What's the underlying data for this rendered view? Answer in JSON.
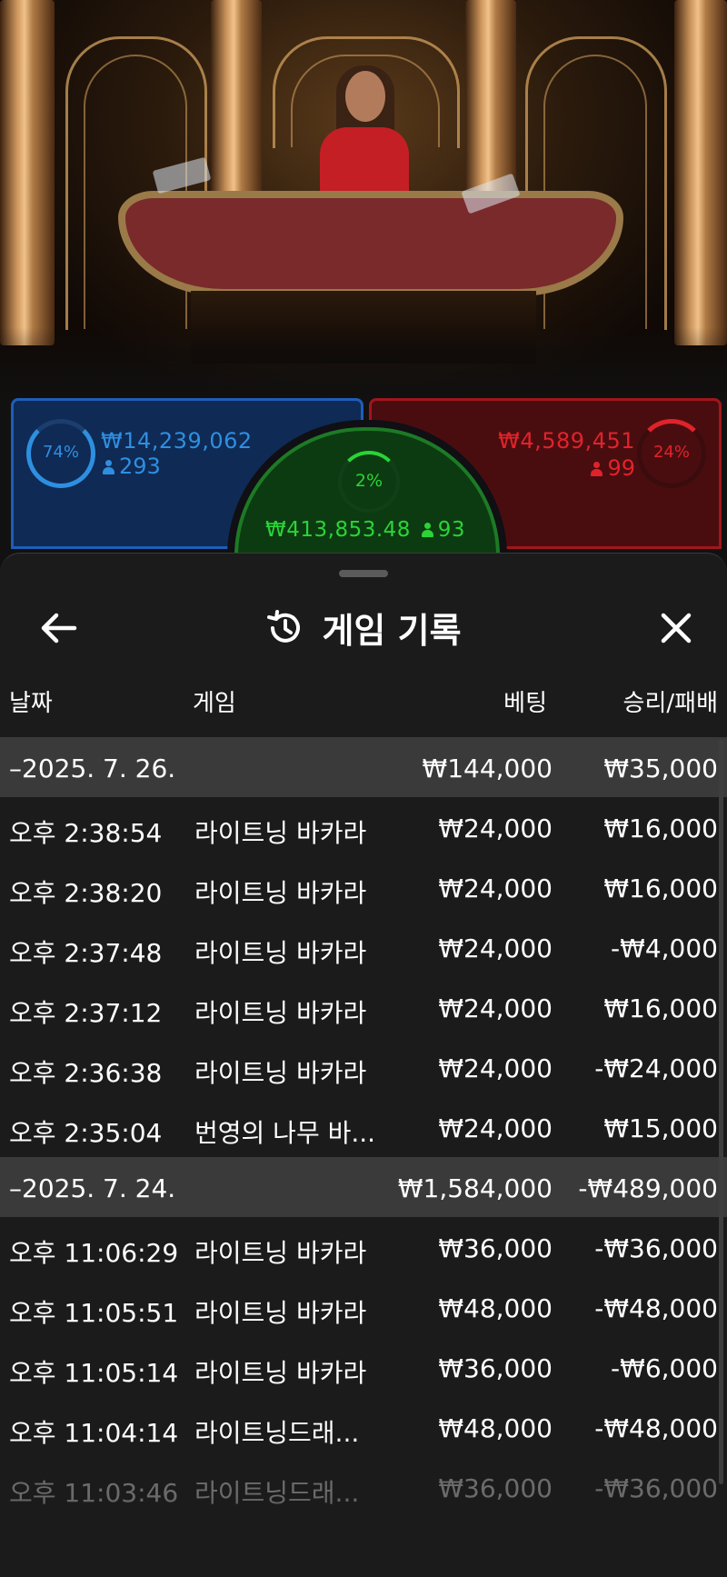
{
  "bet_panels": {
    "player": {
      "percent": "74%",
      "amount": "₩14,239,062",
      "players": "293",
      "color": "#2e8fe0"
    },
    "tie": {
      "percent": "2%",
      "amount": "₩413,853.48",
      "players": "93",
      "color": "#2bd338"
    },
    "banker": {
      "percent": "24%",
      "amount": "₩4,589,451",
      "players": "99",
      "color": "#e0232b"
    }
  },
  "sheet": {
    "title": "게임 기록",
    "icons": {
      "back": "arrow-left-icon",
      "history": "history-icon",
      "close": "close-icon"
    },
    "columns": {
      "date": "날짜",
      "game": "게임",
      "bet": "베팅",
      "win_loss": "승리/패배"
    },
    "groups": [
      {
        "date": "–2025. 7. 26.",
        "bet": "₩144,000",
        "win_loss": "₩35,000",
        "rows": [
          {
            "time": "오후 2:38:54",
            "game": "라이트닝 바카라",
            "bet": "₩24,000",
            "win_loss": "₩16,000"
          },
          {
            "time": "오후 2:38:20",
            "game": "라이트닝 바카라",
            "bet": "₩24,000",
            "win_loss": "₩16,000"
          },
          {
            "time": "오후 2:37:48",
            "game": "라이트닝 바카라",
            "bet": "₩24,000",
            "win_loss": "-₩4,000"
          },
          {
            "time": "오후 2:37:12",
            "game": "라이트닝 바카라",
            "bet": "₩24,000",
            "win_loss": "₩16,000"
          },
          {
            "time": "오후 2:36:38",
            "game": "라이트닝 바카라",
            "bet": "₩24,000",
            "win_loss": "-₩24,000"
          },
          {
            "time": "오후 2:35:04",
            "game": "번영의 나무 바...",
            "bet": "₩24,000",
            "win_loss": "₩15,000"
          }
        ]
      },
      {
        "date": "–2025. 7. 24.",
        "bet": "₩1,584,000",
        "win_loss": "-₩489,000",
        "rows": [
          {
            "time": "오후 11:06:29",
            "game": "라이트닝 바카라",
            "bet": "₩36,000",
            "win_loss": "-₩36,000"
          },
          {
            "time": "오후 11:05:51",
            "game": "라이트닝 바카라",
            "bet": "₩48,000",
            "win_loss": "-₩48,000"
          },
          {
            "time": "오후 11:05:14",
            "game": "라이트닝 바카라",
            "bet": "₩36,000",
            "win_loss": "-₩6,000"
          },
          {
            "time": "오후 11:04:14",
            "game": "라이트닝드래...",
            "bet": "₩48,000",
            "win_loss": "-₩48,000"
          },
          {
            "time": "오후 11:03:46",
            "game": "라이트닝드래...",
            "bet": "₩36,000",
            "win_loss": "-₩36,000"
          }
        ]
      }
    ]
  }
}
